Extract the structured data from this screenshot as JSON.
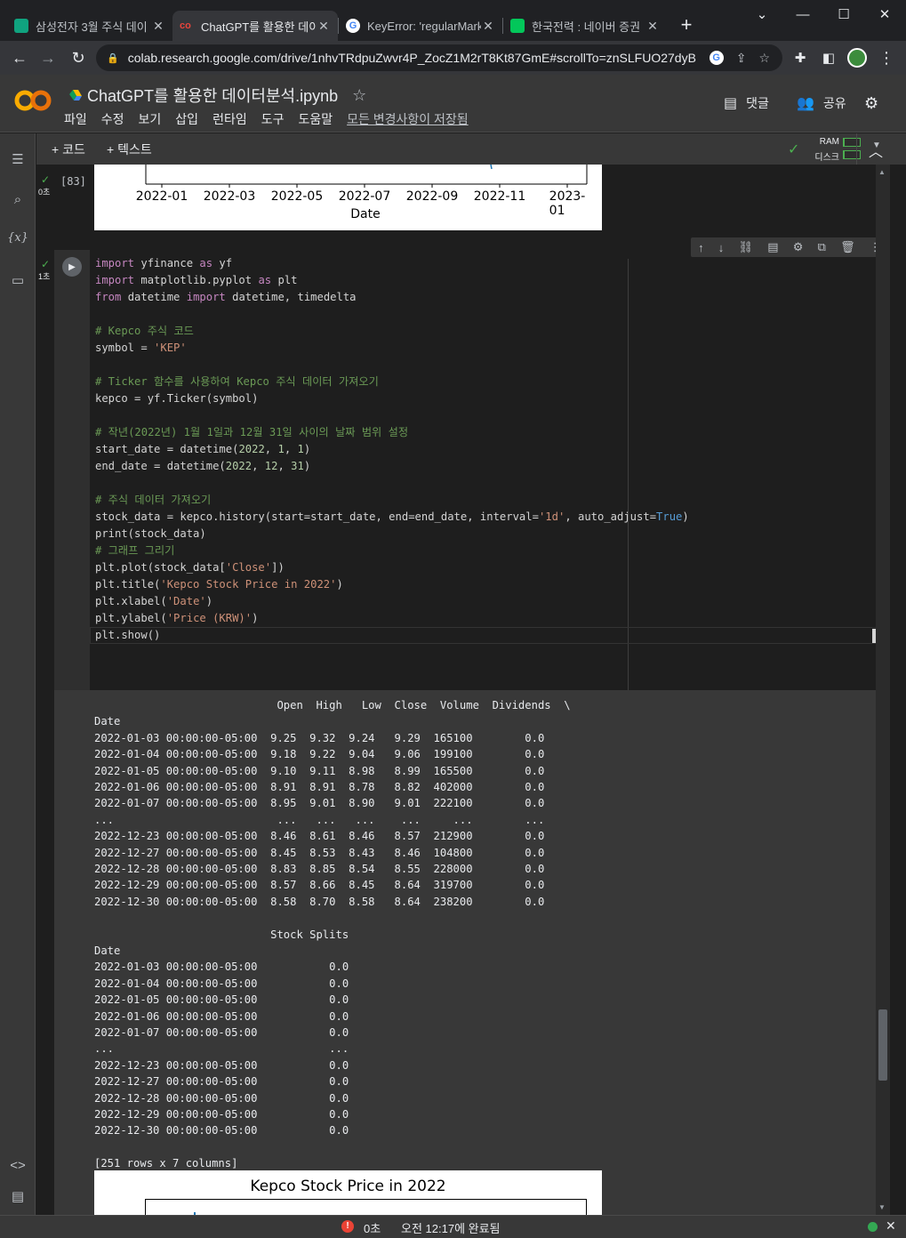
{
  "browser": {
    "tabs": [
      {
        "title": "삼성전자 3월 주식 데이",
        "favicon_color": "#10a37f",
        "active": false
      },
      {
        "title": "ChatGPT를 활용한 데이",
        "favicon_color": "#e8453c",
        "active": true
      },
      {
        "title": "KeyError: 'regularMark",
        "favicon_color": "#4285f4",
        "active": false
      },
      {
        "title": "한국전력 : 네이버 증권",
        "favicon_color": "#03c75a",
        "active": false
      }
    ],
    "new_tab_label": "+",
    "url": "colab.research.google.com/drive/1nhvTRdpuZwvr4P_ZocZ1M2rT8Kt87GmE#scrollTo=znSLFUO27dyB",
    "window_controls": {
      "minimize": "—",
      "maximize": "☐",
      "close": "✕",
      "tabsearch": "⌄"
    }
  },
  "colab": {
    "logo_text": "CO",
    "notebook_title": "ChatGPT를 활용한 데이터분석.ipynb",
    "menu": [
      "파일",
      "수정",
      "보기",
      "삽입",
      "런타임",
      "도구",
      "도움말"
    ],
    "saved_status": "모든 변경사항이 저장됨",
    "comment_label": "댓글",
    "share_label": "공유",
    "add_code_label": "+ 코드",
    "add_text_label": "+ 텍스트",
    "ram_label": "RAM",
    "disk_label": "디스크",
    "ram_usage": 0.05,
    "disk_usage": 0.05
  },
  "prev_cell": {
    "exec_count": "[83]",
    "exec_time": "0초",
    "x_ticks": [
      "2022-01",
      "2022-03",
      "2022-05",
      "2022-07",
      "2022-09",
      "2022-11",
      "2023-01"
    ],
    "xlabel": "Date"
  },
  "code_cell": {
    "exec_time": "1초",
    "lines": [
      [
        [
          "kw",
          "import"
        ],
        [
          "t",
          " yfinance "
        ],
        [
          "kw",
          "as"
        ],
        [
          "t",
          " yf"
        ]
      ],
      [
        [
          "kw",
          "import"
        ],
        [
          "t",
          " matplotlib.pyplot "
        ],
        [
          "kw",
          "as"
        ],
        [
          "t",
          " plt"
        ]
      ],
      [
        [
          "kw",
          "from"
        ],
        [
          "t",
          " datetime "
        ],
        [
          "kw",
          "import"
        ],
        [
          "t",
          " datetime, timedelta"
        ]
      ],
      [],
      [
        [
          "cm",
          "# Kepco 주식 코드"
        ]
      ],
      [
        [
          "t",
          "symbol = "
        ],
        [
          "str",
          "'KEP'"
        ]
      ],
      [],
      [
        [
          "cm",
          "# Ticker 함수를 사용하여 Kepco 주식 데이터 가져오기"
        ]
      ],
      [
        [
          "t",
          "kepco = yf.Ticker(symbol)"
        ]
      ],
      [],
      [
        [
          "cm",
          "# 작년(2022년) 1월 1일과 12월 31일 사이의 날짜 범위 설정"
        ]
      ],
      [
        [
          "t",
          "start_date = datetime("
        ],
        [
          "num",
          "2022"
        ],
        [
          "t",
          ", "
        ],
        [
          "num",
          "1"
        ],
        [
          "t",
          ", "
        ],
        [
          "num",
          "1"
        ],
        [
          "t",
          ")"
        ]
      ],
      [
        [
          "t",
          "end_date = datetime("
        ],
        [
          "num",
          "2022"
        ],
        [
          "t",
          ", "
        ],
        [
          "num",
          "12"
        ],
        [
          "t",
          ", "
        ],
        [
          "num",
          "31"
        ],
        [
          "t",
          ")"
        ]
      ],
      [],
      [
        [
          "cm",
          "# 주식 데이터 가져오기"
        ]
      ],
      [
        [
          "t",
          "stock_data = kepco.history(start=start_date, end=end_date, interval="
        ],
        [
          "str",
          "'1d'"
        ],
        [
          "t",
          ", auto_adjust="
        ],
        [
          "bool",
          "True"
        ],
        [
          "t",
          ")"
        ]
      ],
      [
        [
          "t",
          "print(stock_data)"
        ]
      ],
      [
        [
          "cm",
          "# 그래프 그리기"
        ]
      ],
      [
        [
          "t",
          "plt.plot(stock_data["
        ],
        [
          "str",
          "'Close'"
        ],
        [
          "t",
          "])"
        ]
      ],
      [
        [
          "t",
          "plt.title("
        ],
        [
          "str",
          "'Kepco Stock Price in 2022'"
        ],
        [
          "t",
          ")"
        ]
      ],
      [
        [
          "t",
          "plt.xlabel("
        ],
        [
          "str",
          "'Date'"
        ],
        [
          "t",
          ")"
        ]
      ],
      [
        [
          "t",
          "plt.ylabel("
        ],
        [
          "str",
          "'Price (KRW)'"
        ],
        [
          "t",
          ")"
        ]
      ],
      [
        [
          "t",
          "plt.show()"
        ]
      ]
    ]
  },
  "output": {
    "lines": [
      "                            Open  High   Low  Close  Volume  Dividends  \\",
      "Date",
      "2022-01-03 00:00:00-05:00  9.25  9.32  9.24   9.29  165100        0.0",
      "2022-01-04 00:00:00-05:00  9.18  9.22  9.04   9.06  199100        0.0",
      "2022-01-05 00:00:00-05:00  9.10  9.11  8.98   8.99  165500        0.0",
      "2022-01-06 00:00:00-05:00  8.91  8.91  8.78   8.82  402000        0.0",
      "2022-01-07 00:00:00-05:00  8.95  9.01  8.90   9.01  222100        0.0",
      "...                         ...   ...   ...    ...     ...        ...",
      "2022-12-23 00:00:00-05:00  8.46  8.61  8.46   8.57  212900        0.0",
      "2022-12-27 00:00:00-05:00  8.45  8.53  8.43   8.46  104800        0.0",
      "2022-12-28 00:00:00-05:00  8.83  8.85  8.54   8.55  228000        0.0",
      "2022-12-29 00:00:00-05:00  8.57  8.66  8.45   8.64  319700        0.0",
      "2022-12-30 00:00:00-05:00  8.58  8.70  8.58   8.64  238200        0.0",
      "",
      "                           Stock Splits",
      "Date",
      "2022-01-03 00:00:00-05:00           0.0",
      "2022-01-04 00:00:00-05:00           0.0",
      "2022-01-05 00:00:00-05:00           0.0",
      "2022-01-06 00:00:00-05:00           0.0",
      "2022-01-07 00:00:00-05:00           0.0",
      "...                                 ...",
      "2022-12-23 00:00:00-05:00           0.0",
      "2022-12-27 00:00:00-05:00           0.0",
      "2022-12-28 00:00:00-05:00           0.0",
      "2022-12-29 00:00:00-05:00           0.0",
      "2022-12-30 00:00:00-05:00           0.0",
      "",
      "[251 rows x 7 columns]"
    ],
    "plot_title": "Kepco Stock Price in 2022"
  },
  "status": {
    "exec_time": "0초",
    "completed_text": "오전 12:17에 완료됨"
  }
}
